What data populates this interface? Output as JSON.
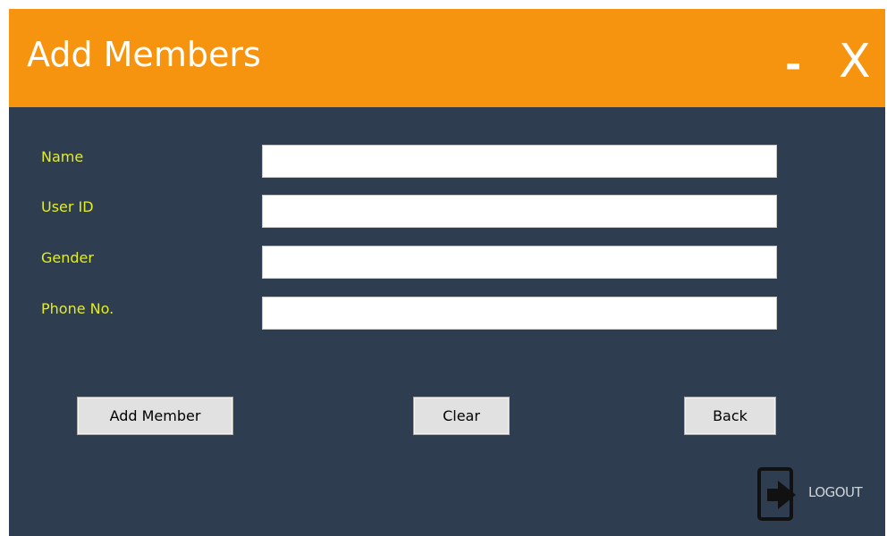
{
  "window": {
    "title": "Add Members",
    "minimize_label": "-",
    "close_label": "X"
  },
  "form": {
    "fields": [
      {
        "label": "Name",
        "value": ""
      },
      {
        "label": "User ID",
        "value": ""
      },
      {
        "label": "Gender",
        "value": ""
      },
      {
        "label": "Phone No.",
        "value": ""
      }
    ]
  },
  "buttons": {
    "add_member": "Add Member",
    "clear": "Clear",
    "back": "Back"
  },
  "logout": {
    "label": "LOGOUT",
    "icon": "logout-icon"
  },
  "colors": {
    "titlebar": "#f7940f",
    "background": "#2e3e50",
    "label_text": "#e3ee21"
  }
}
